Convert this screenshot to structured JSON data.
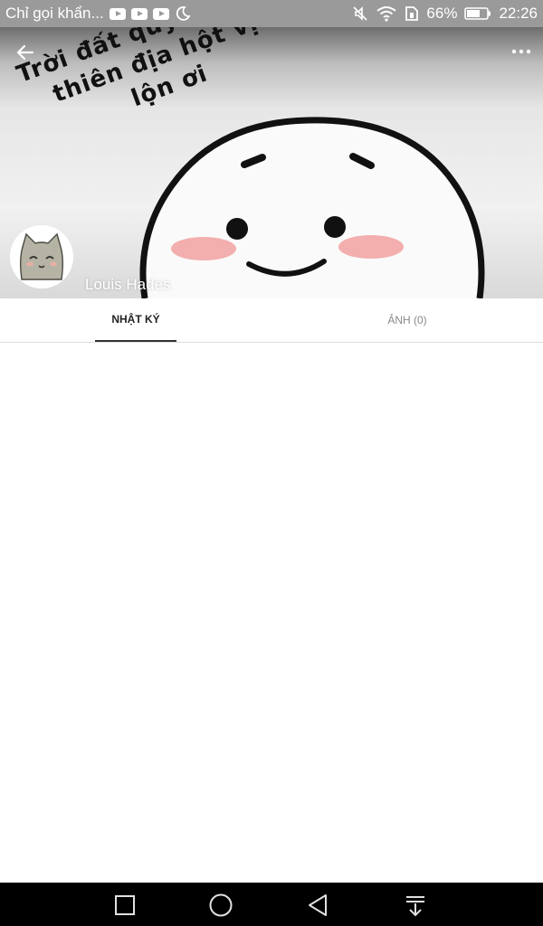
{
  "status_bar": {
    "notification": "Chỉ gọi khẩn...",
    "battery": "66%",
    "time": "22:26",
    "icons": [
      "youtube-icon",
      "youtube-icon",
      "youtube-icon",
      "moon-icon",
      "mute-icon",
      "wifi-icon",
      "sim-icon",
      "battery-icon"
    ]
  },
  "cover": {
    "caption_lines": [
      "Trời đất quỷ thần",
      "thiên địa hột vịt",
      "lộn ơi"
    ],
    "cheek_color": "#f2a5a5"
  },
  "profile": {
    "name": "Louis Hades"
  },
  "tabs": [
    {
      "label": "NHẬT KÝ",
      "active": true
    },
    {
      "label": "ẢNH (0)",
      "active": false
    }
  ],
  "nav_bar": {
    "buttons": [
      "recent-apps-icon",
      "home-icon",
      "back-nav-icon",
      "notification-pull-icon"
    ]
  }
}
